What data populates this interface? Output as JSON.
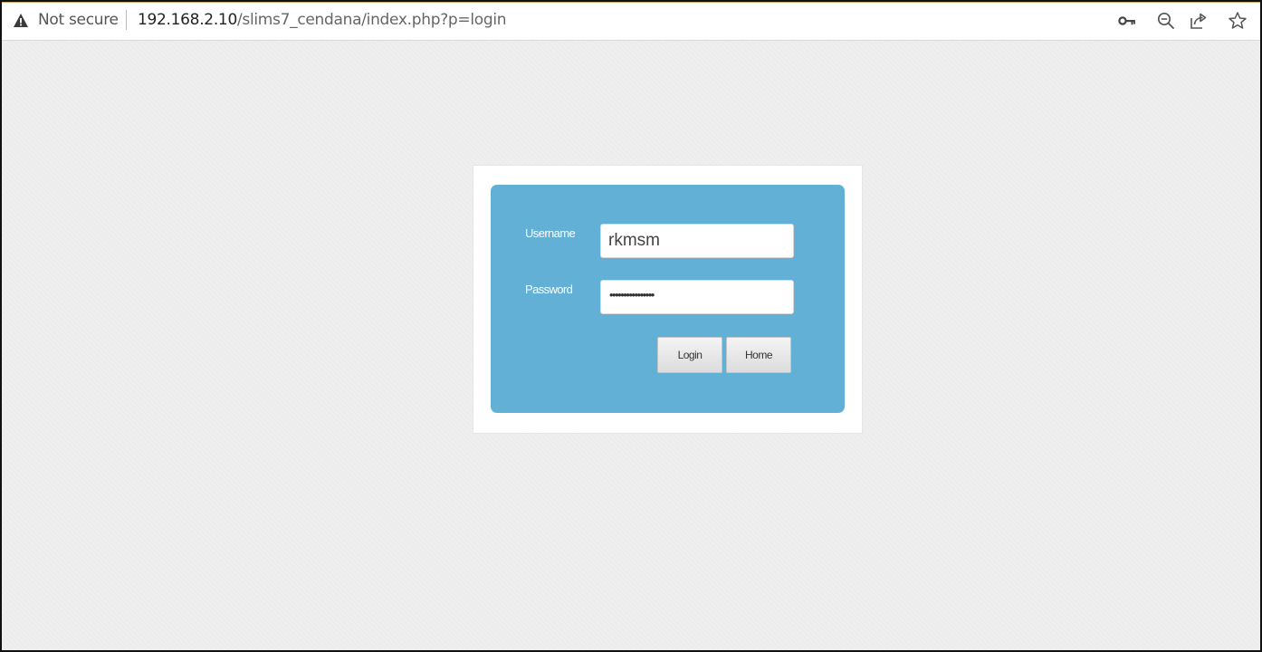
{
  "browser": {
    "security_label": "Not secure",
    "url_host": "192.168.2.10",
    "url_path": "/slims7_cendana/index.php?p=login",
    "icons": [
      "warning-icon",
      "key-icon",
      "zoom-out-icon",
      "share-icon",
      "star-icon"
    ]
  },
  "login": {
    "username_label": "Username",
    "username_value": "rkmsm",
    "password_label": "Password",
    "password_masked": "••••••••••••••••",
    "login_button": "Login",
    "home_button": "Home"
  },
  "colors": {
    "panel": "#62b0d6",
    "page_background": "#efefef"
  }
}
